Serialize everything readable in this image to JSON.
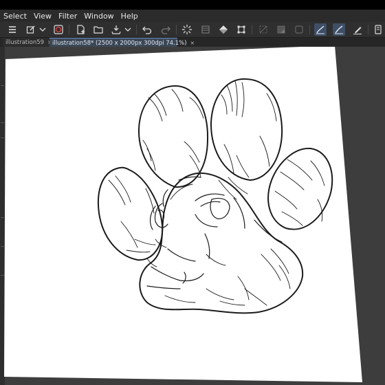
{
  "menu": {
    "items": [
      "Select",
      "View",
      "Filter",
      "Window",
      "Help"
    ]
  },
  "toolbar": {
    "icons": [
      "menu-icon",
      "new-layer-icon",
      "chevron-down-icon",
      "color-icon",
      "new-file-icon",
      "open-folder-icon",
      "save-icon",
      "chevron-down-icon",
      "undo-icon",
      "redo-icon",
      "loading-spinner-icon",
      "clear-icon",
      "fill-icon",
      "transform-icon",
      "deselect-icon",
      "selection-icon",
      "frame-icon",
      "pen-stroke-icon",
      "pen-curve-icon",
      "pen-icon",
      "tablet-icon"
    ]
  },
  "tabs": [
    {
      "label": "illustration59",
      "close": "×"
    },
    {
      "label": "illustration58* (2500 x 2000px 300dpi 74.1%)",
      "close": "×"
    }
  ],
  "colors": {
    "menubar": "#2b2b2b",
    "toolbar": "#2f2f2f",
    "workspace": "#3d3d3d",
    "active_tab": "#3c4756",
    "accent": "#6b8cc0",
    "paper": "#ffffff",
    "ink": "#1a1a1a"
  }
}
